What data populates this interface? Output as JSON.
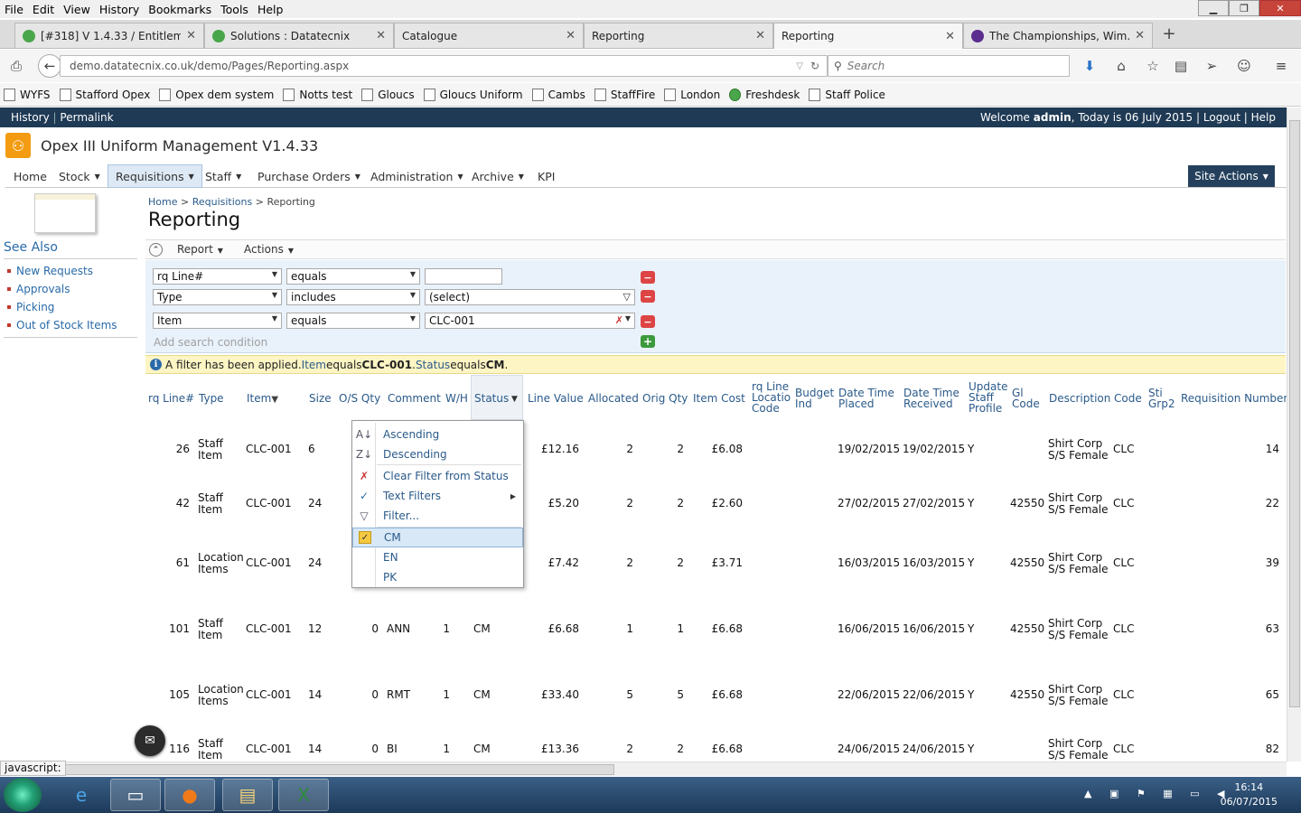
{
  "browser": {
    "menu": [
      "File",
      "Edit",
      "View",
      "History",
      "Bookmarks",
      "Tools",
      "Help"
    ],
    "tabs": [
      {
        "label": "[#318] V 1.4.33 / Entitleme...",
        "icon_color": "#4aa64a"
      },
      {
        "label": "Solutions : Datatecnix",
        "icon_color": "#4aa64a"
      },
      {
        "label": "Catalogue",
        "icon_color": ""
      },
      {
        "label": "Reporting",
        "icon_color": ""
      },
      {
        "label": "Reporting",
        "icon_color": ""
      },
      {
        "label": "The Championships, Wim...",
        "icon_color": "#5b2d8e"
      }
    ],
    "url": "demo.datatecnix.co.uk/demo/Pages/Reporting.aspx",
    "url_host": "demo.datatecnix.co.uk",
    "search_placeholder": "Search",
    "bookmarks": [
      "WYFS",
      "Stafford Opex",
      "Opex dem system",
      "Notts test",
      "Gloucs",
      "Gloucs Uniform",
      "Cambs",
      "StaffFire",
      "London",
      "Freshdesk",
      "Staff Police"
    ]
  },
  "app": {
    "top_left": [
      "History",
      "Permalink"
    ],
    "welcome_prefix": "Welcome ",
    "welcome_user": "admin",
    "welcome_suffix": ", Today is 06 July 2015 | ",
    "logout": "Logout",
    "help": "Help",
    "title": "Opex III Uniform Management V1.4.33",
    "menu": [
      "Home",
      "Stock",
      "Requisitions",
      "Staff",
      "Purchase Orders",
      "Administration",
      "Archive",
      "KPI"
    ],
    "site_actions": "Site Actions",
    "see_also": {
      "title": "See Also",
      "items": [
        "New Requests",
        "Approvals",
        "Picking",
        "Out of Stock Items"
      ]
    },
    "breadcrumb": [
      "Home",
      "Requisitions",
      "Reporting"
    ],
    "page_title": "Reporting"
  },
  "report": {
    "menu": [
      "Report",
      "Actions"
    ],
    "filters": [
      {
        "field": "rq Line#",
        "op": "equals",
        "value": ""
      },
      {
        "field": "Type",
        "op": "includes",
        "value": "(select)"
      },
      {
        "field": "Item",
        "op": "equals",
        "value": "CLC-001"
      }
    ],
    "add_condition": "Add search condition",
    "info": {
      "prefix": "A filter has been applied. ",
      "f1": "Item",
      "t1": " equals ",
      "v1": "CLC-001",
      "sep": ". ",
      "f2": "Status",
      "t2": " equals ",
      "v2": "CM",
      "end": "."
    }
  },
  "grid": {
    "headers": [
      "rq Line#",
      "Type",
      "Item",
      "Size",
      "O/S Qty",
      "Comment",
      "W/H",
      "Status",
      "Line Value",
      "Allocated",
      "Orig Qty",
      "Item Cost",
      "rq Line Locatio Code",
      "Budget Ind",
      "Date Time Placed",
      "Date Time Received",
      "Update Staff Profile",
      "Gl Code",
      "Description",
      "Code",
      "Sti Grp2",
      "Requisition Number"
    ],
    "rows": [
      {
        "line": "26",
        "type1": "Staff",
        "type2": "Item",
        "item": "CLC-001",
        "size": "6",
        "os": "",
        "comment": "",
        "wh": "",
        "status": "",
        "value": "£12.16",
        "alloc": "2",
        "orig": "2",
        "cost": "£6.08",
        "placed": "19/02/2015",
        "received": "19/02/2015",
        "update": "Y",
        "gl": "",
        "desc1": "Shirt Corp",
        "desc2": "S/S Female",
        "code": "CLC",
        "req": "14"
      },
      {
        "line": "42",
        "type1": "Staff",
        "type2": "Item",
        "item": "CLC-001",
        "size": "24",
        "os": "",
        "comment": "",
        "wh": "",
        "status": "",
        "value": "£5.20",
        "alloc": "2",
        "orig": "2",
        "cost": "£2.60",
        "placed": "27/02/2015",
        "received": "27/02/2015",
        "update": "Y",
        "gl": "42550",
        "desc1": "Shirt Corp",
        "desc2": "S/S Female",
        "code": "CLC",
        "req": "22"
      },
      {
        "line": "61",
        "type1": "Location",
        "type2": "Items",
        "item": "CLC-001",
        "size": "24",
        "os": "",
        "comment": "",
        "wh": "",
        "status": "",
        "value": "£7.42",
        "alloc": "2",
        "orig": "2",
        "cost": "£3.71",
        "placed": "16/03/2015",
        "received": "16/03/2015",
        "update": "Y",
        "gl": "42550",
        "desc1": "Shirt Corp",
        "desc2": "S/S Female",
        "code": "CLC",
        "req": "39"
      },
      {
        "line": "101",
        "type1": "Staff",
        "type2": "Item",
        "item": "CLC-001",
        "size": "12",
        "os": "0",
        "comment": "ANN",
        "wh": "1",
        "status": "CM",
        "value": "£6.68",
        "alloc": "1",
        "orig": "1",
        "cost": "£6.68",
        "placed": "16/06/2015",
        "received": "16/06/2015",
        "update": "Y",
        "gl": "42550",
        "desc1": "Shirt Corp",
        "desc2": "S/S Female",
        "code": "CLC",
        "req": "63"
      },
      {
        "line": "105",
        "type1": "Location",
        "type2": "Items",
        "item": "CLC-001",
        "size": "14",
        "os": "0",
        "comment": "RMT",
        "wh": "1",
        "status": "CM",
        "value": "£33.40",
        "alloc": "5",
        "orig": "5",
        "cost": "£6.68",
        "placed": "22/06/2015",
        "received": "22/06/2015",
        "update": "Y",
        "gl": "42550",
        "desc1": "Shirt Corp",
        "desc2": "S/S Female",
        "code": "CLC",
        "req": "65"
      },
      {
        "line": "116",
        "type1": "Staff",
        "type2": "Item",
        "item": "CLC-001",
        "size": "14",
        "os": "0",
        "comment": "BI",
        "wh": "1",
        "status": "CM",
        "value": "£13.36",
        "alloc": "2",
        "orig": "2",
        "cost": "£6.68",
        "placed": "24/06/2015",
        "received": "24/06/2015",
        "update": "Y",
        "gl": "",
        "desc1": "Shirt Corp",
        "desc2": "S/S Female",
        "code": "CLC",
        "req": "82"
      }
    ]
  },
  "context_menu": {
    "items": [
      "Ascending",
      "Descending",
      "Clear Filter from Status",
      "Text Filters",
      "Filter..."
    ],
    "values": [
      "CM",
      "EN",
      "PK"
    ],
    "checked": "CM"
  },
  "status_text": "javascript:",
  "clock": {
    "time": "16:14",
    "date": "06/07/2015"
  }
}
